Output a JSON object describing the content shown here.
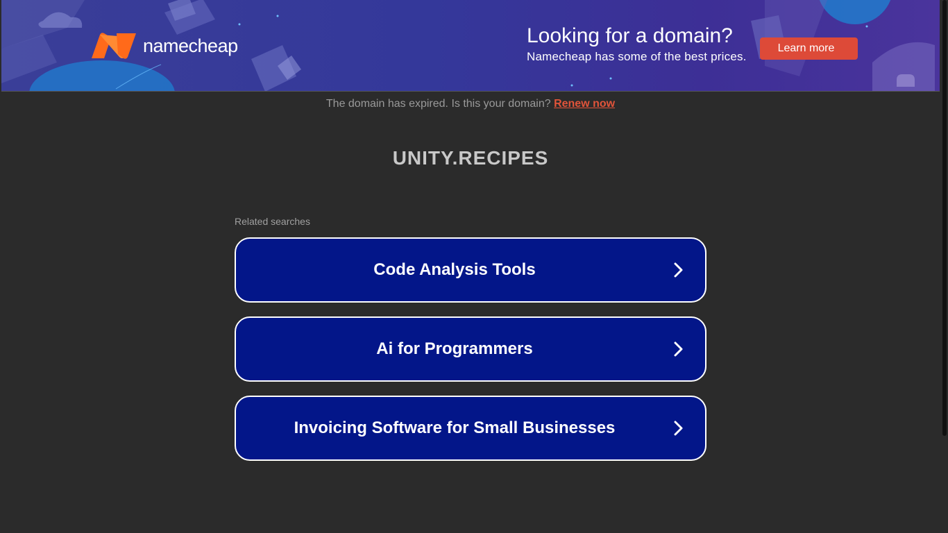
{
  "banner": {
    "logo_text": "namecheap",
    "title": "Looking for a domain?",
    "subtitle": "Namecheap has some of the best prices.",
    "cta_label": "Learn more",
    "colors": {
      "background": "#3a3e98",
      "cta": "#dd4a38",
      "logo_orange": "#ff6a1a"
    }
  },
  "notice": {
    "text": "The domain has expired. Is this your domain?",
    "link_label": "Renew now"
  },
  "domain": {
    "name": "UNITY.RECIPES"
  },
  "related": {
    "heading": "Related searches",
    "items": [
      {
        "label": "Code Analysis Tools",
        "icon": "chevron-right-icon"
      },
      {
        "label": "Ai for Programmers",
        "icon": "chevron-right-icon"
      },
      {
        "label": "Invoicing Software for Small Businesses",
        "icon": "chevron-right-icon"
      }
    ]
  },
  "colors": {
    "page_background": "#2b2b2b",
    "button_background": "#031689",
    "link": "#e2543a"
  }
}
